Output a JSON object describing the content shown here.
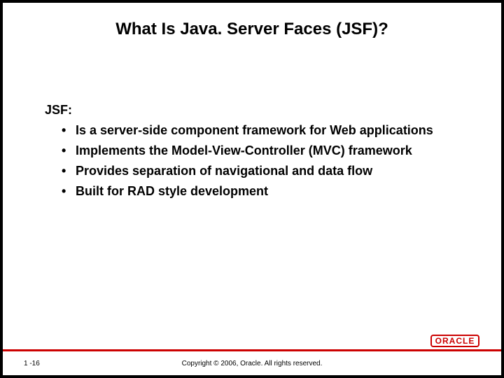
{
  "slide": {
    "title": "What Is Java. Server Faces (JSF)?",
    "intro": "JSF:",
    "bullets": [
      "Is a server-side component framework for Web applications",
      "Implements the Model-View-Controller (MVC) framework",
      "Provides separation of navigational and data flow",
      "Built for RAD style development"
    ],
    "slide_number": "1 -16",
    "copyright": "Copyright © 2006, Oracle. All rights reserved.",
    "logo_text": "ORACLE"
  }
}
